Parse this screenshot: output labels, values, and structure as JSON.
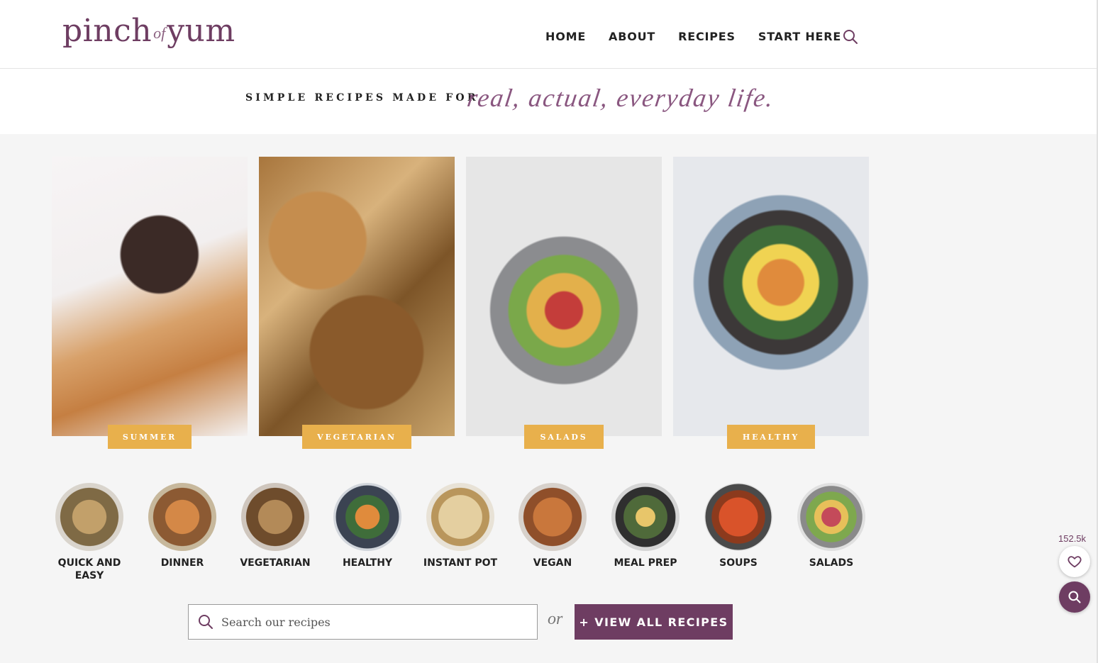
{
  "brand": {
    "logo_part1": "pinch",
    "logo_part2": "of",
    "logo_part3": "yum"
  },
  "nav": {
    "items": [
      "HOME",
      "ABOUT",
      "RECIPES",
      "START HERE"
    ],
    "search_icon": "search-icon"
  },
  "tagline": {
    "text": "SIMPLE RECIPES MADE FOR",
    "script": "real, actual, everyday life."
  },
  "features": [
    {
      "label": "SUMMER",
      "image": "chocolate-bar-photo"
    },
    {
      "label": "VEGETARIAN",
      "image": "pizza-photo"
    },
    {
      "label": "SALADS",
      "image": "salad-bowl-photo"
    },
    {
      "label": "HEALTHY",
      "image": "grain-bowl-photo"
    }
  ],
  "categories": [
    "QUICK AND EASY",
    "DINNER",
    "VEGETARIAN",
    "HEALTHY",
    "INSTANT POT",
    "VEGAN",
    "MEAL PREP",
    "SOUPS",
    "SALADS"
  ],
  "search": {
    "placeholder": "Search our recipes",
    "or_text": "or",
    "button_label": "+ VIEW ALL RECIPES"
  },
  "favorites": {
    "count": "152.5k"
  },
  "colors": {
    "brand_plum": "#6e3d62",
    "badge_gold": "#e8b04c",
    "background": "#f5f5f5"
  }
}
